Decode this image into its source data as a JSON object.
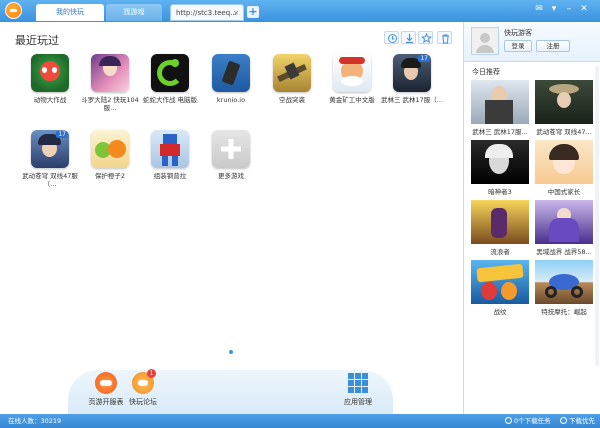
{
  "tabs": [
    {
      "label": "我的快玩"
    },
    {
      "label": "找游戏"
    },
    {
      "label": "http://stc3.teeq..."
    }
  ],
  "main": {
    "title": "最近玩过",
    "tools": [
      "clock-icon",
      "download-icon",
      "star-icon",
      "trash-icon"
    ],
    "games": [
      {
        "label": "动物大作战"
      },
      {
        "label": "斗罗大陆2 快玩104服..."
      },
      {
        "label": "蛇蛇大作战 电脑版"
      },
      {
        "label": "krunio.io"
      },
      {
        "label": "空战突袭"
      },
      {
        "label": "黄金矿工中文版"
      },
      {
        "label": "武林三 武林17服（..."
      },
      {
        "label": "武动苍穹 双线47服（..."
      },
      {
        "label": "保护橙子2"
      },
      {
        "label": "组装钢普拉"
      },
      {
        "label": "更多游戏"
      }
    ],
    "badges": {
      "badge_17": "17"
    }
  },
  "dock": {
    "items": [
      {
        "label": "页游开服表"
      },
      {
        "label": "快玩论坛",
        "badge": "1"
      },
      {
        "label": "应用管理"
      }
    ]
  },
  "user": {
    "name": "快玩游客",
    "login": "登录",
    "register": "注册"
  },
  "recommend": {
    "title": "今日推荐",
    "items": [
      {
        "label": "武林三 武林17服..."
      },
      {
        "label": "武动苍穹 双线47..."
      },
      {
        "label": "暗神者3"
      },
      {
        "label": "中国式家长"
      },
      {
        "label": "流浪者"
      },
      {
        "label": "黑域战界 战界58..."
      },
      {
        "label": "战纹"
      },
      {
        "label": "特技摩托：崛起"
      }
    ]
  },
  "status": {
    "online": "在线人数：30219",
    "tasks": "0个下载任务",
    "priority": "下载优先"
  },
  "colors": {
    "accent": "#3b93de",
    "title_bar": "#4aa3ea"
  }
}
